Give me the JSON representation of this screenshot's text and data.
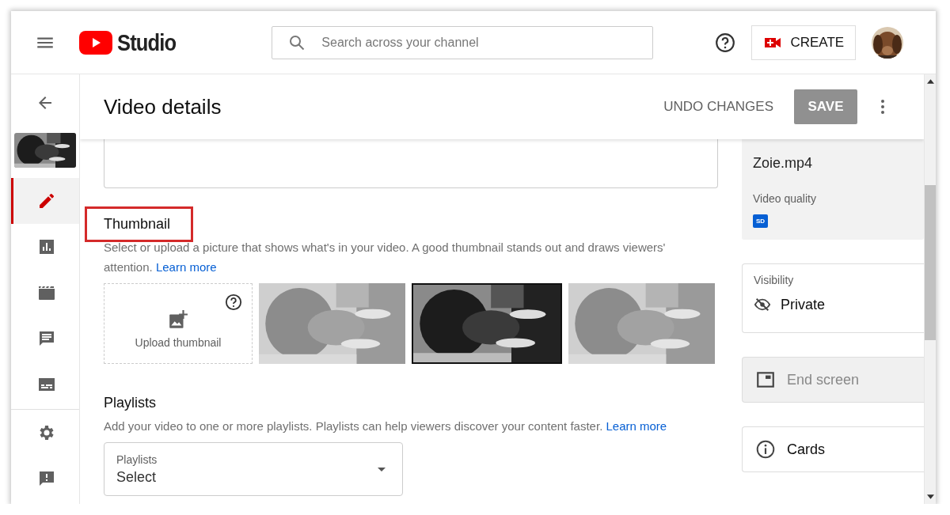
{
  "topbar": {
    "brand": "Studio",
    "search": {
      "placeholder": "Search across your channel"
    },
    "create_button": "CREATE"
  },
  "sidebar": {
    "items": [
      {
        "kind": "edit",
        "selected": true
      },
      {
        "kind": "analytics",
        "selected": false
      },
      {
        "kind": "editor",
        "selected": false
      },
      {
        "kind": "comments",
        "selected": false
      },
      {
        "kind": "subtitles",
        "selected": false
      }
    ],
    "footer_items": [
      {
        "kind": "settings"
      },
      {
        "kind": "feedback"
      }
    ]
  },
  "header": {
    "title": "Video details",
    "undo_button": "UNDO CHANGES",
    "save_button": "SAVE",
    "save_disabled": true
  },
  "thumbnail_section": {
    "title": "Thumbnail",
    "highlighted": true,
    "description": "Select or upload a picture that shows what's in your video. A good thumbnail stands out and draws viewers' attention.",
    "link": "Learn more",
    "upload_label": "Upload thumbnail",
    "thumbnails": [
      {
        "selected": false
      },
      {
        "selected": true
      },
      {
        "selected": false
      }
    ]
  },
  "playlists_section": {
    "title": "Playlists",
    "description": "Add your video to one or more playlists. Playlists can help viewers discover your content faster.",
    "link": "Learn more",
    "dropdown": {
      "label": "Playlists",
      "value": "Select"
    }
  },
  "file_card": {
    "filename": "Zoie.mp4",
    "quality_label": "Video quality",
    "quality_badge": "SD"
  },
  "visibility": {
    "label": "Visibility",
    "value": "Private"
  },
  "side_actions": [
    {
      "kind": "end_screen",
      "label": "End screen",
      "disabled": true
    },
    {
      "kind": "cards",
      "label": "Cards",
      "disabled": false
    }
  ]
}
